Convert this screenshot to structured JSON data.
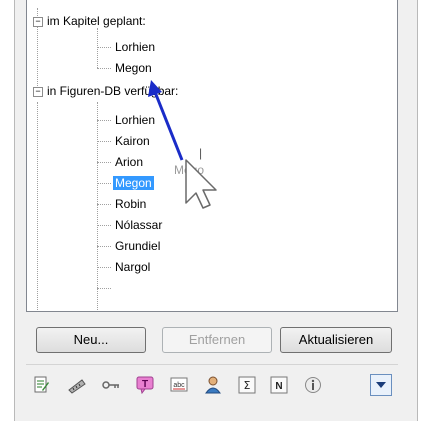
{
  "tree": {
    "group1_label": "im Kapitel geplant:",
    "group1_items": [
      "Lorhien",
      "Megon"
    ],
    "group2_label": "in Figuren-DB verfügbar:",
    "group2_items": [
      "Lorhien",
      "Kairon",
      "Arion",
      "Megon",
      "Robin",
      "Nólassar",
      "Grundiel",
      "Nargol"
    ],
    "selected_item": "Megon"
  },
  "drag": {
    "ghost_text": "Mego",
    "caret": "|"
  },
  "buttons": {
    "new": "Neu...",
    "remove": "Entfernen",
    "refresh": "Aktualisieren"
  },
  "toolbar_icons": [
    "document-edit-icon",
    "ruler-icon",
    "key-icon",
    "speech-bubble-text-icon",
    "spellcheck-icon",
    "person-icon",
    "sum-icon",
    "n-box-icon",
    "info-icon",
    "dropdown-arrow-icon"
  ],
  "colors": {
    "selection": "#3399ff",
    "arrow": "#1a2cc8"
  }
}
